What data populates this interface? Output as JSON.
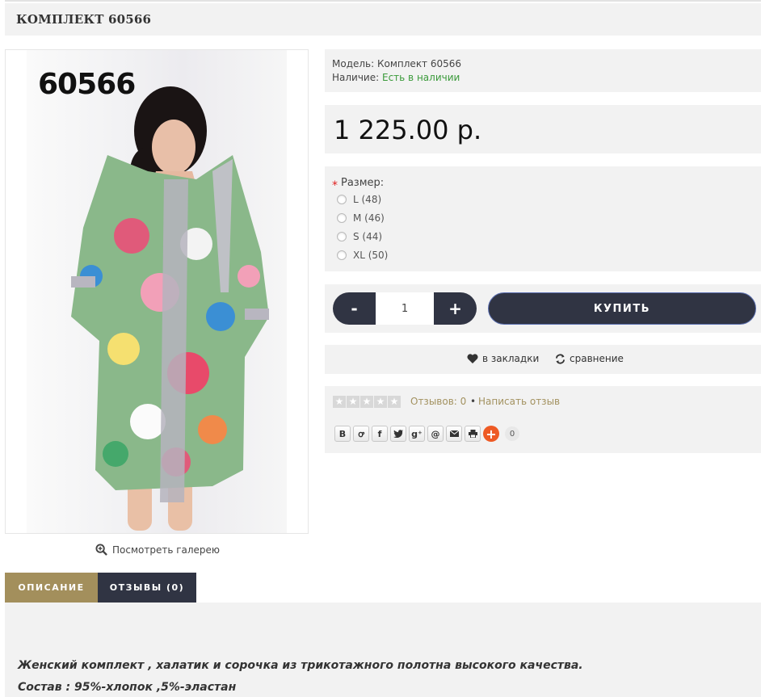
{
  "page_title": "КОМПЛЕКТ 60566",
  "product_image": {
    "code_label": "60566",
    "gallery_link": "Посмотреть галерею",
    "gallery_icon": "zoom-in-icon"
  },
  "info": {
    "model_label": "Модель:",
    "model_value": "Комплект 60566",
    "stock_label": "Наличие:",
    "stock_value": "Есть в наличии"
  },
  "price": "1 225.00 р.",
  "options": {
    "required_mark": "*",
    "size_label": "Размер:",
    "sizes": [
      "L (48)",
      "M (46)",
      "S (44)",
      "XL (50)"
    ]
  },
  "cart": {
    "minus_label": "-",
    "quantity": "1",
    "plus_label": "+",
    "buy_label": "КУПИТЬ"
  },
  "actions": {
    "wishlist_label": "в закладки",
    "wishlist_icon": "heart-icon",
    "compare_label": "сравнение",
    "compare_icon": "refresh-icon"
  },
  "reviews": {
    "rating": 0,
    "reviews_count_label": "Отзывов: 0",
    "separator": "•",
    "write_review_label": "Написать отзыв"
  },
  "share": {
    "buttons": [
      "vk-icon",
      "odnoklassniki-icon",
      "facebook-icon",
      "twitter-icon",
      "google-plus-icon",
      "mail-icon",
      "email-icon",
      "print-icon"
    ],
    "more_label": "+",
    "count": "0"
  },
  "tabs": [
    {
      "label": "ОПИСАНИЕ",
      "active": true
    },
    {
      "label": "ОТЗЫВЫ (0)",
      "active": false
    }
  ],
  "description": {
    "line1": "Женский комплект , халатик и сорочка из трикотажного полотна высокого качества.",
    "line2": "Состав : 95%-хлопок ,5%-эластан"
  },
  "colors": {
    "panel_bg": "#f2f2f2",
    "dark_button": "#303443",
    "gold_accent": "#a38f5c",
    "in_stock_green": "#3a9a3a",
    "link_gold": "#a39260"
  }
}
